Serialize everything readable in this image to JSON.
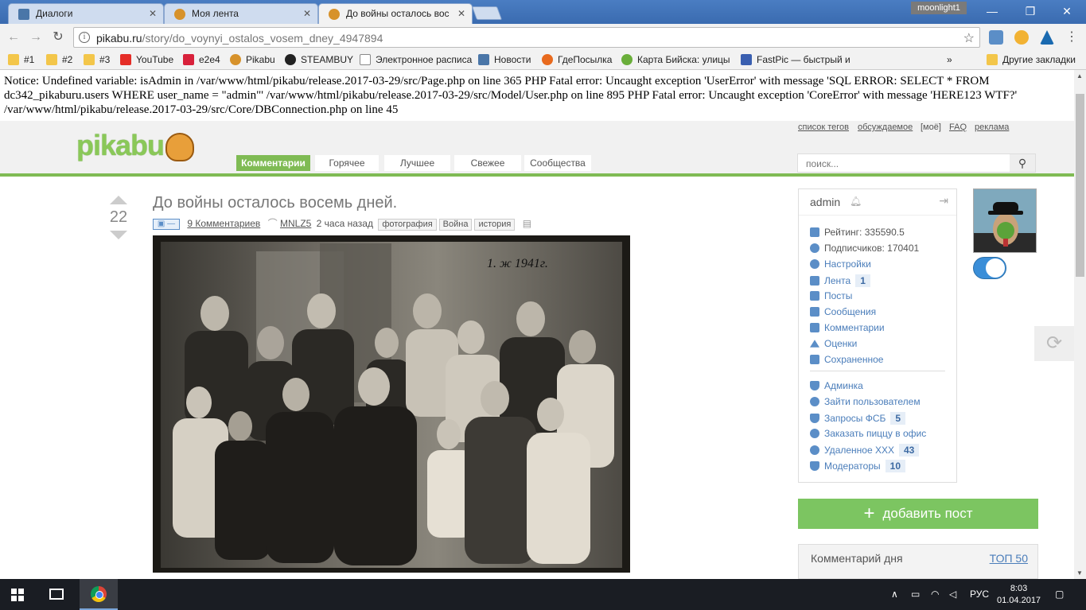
{
  "browser": {
    "tabs": [
      {
        "title": "Диалоги",
        "icon": "vk-icon",
        "color": "#4a76a8"
      },
      {
        "title": "Моя лента",
        "icon": "pikabu-icon",
        "color": "#d7922b"
      },
      {
        "title": "До войны осталось вос",
        "icon": "pikabu-icon",
        "color": "#d7922b"
      }
    ],
    "profile_name": "moonlight1",
    "url_domain": "pikabu.ru",
    "url_path": "/story/do_voynyi_ostalos_vosem_dney_4947894",
    "bookmarks": [
      {
        "label": "#1",
        "icon": "folder-icon"
      },
      {
        "label": "#2",
        "icon": "folder-icon"
      },
      {
        "label": "#3",
        "icon": "folder-icon"
      },
      {
        "label": "YouTube",
        "icon": "youtube-icon"
      },
      {
        "label": "e2e4",
        "icon": "e2e4-icon"
      },
      {
        "label": "Pikabu",
        "icon": "pikabu-icon"
      },
      {
        "label": "STEAMBUY",
        "icon": "steambuy-icon"
      },
      {
        "label": "Электронное расписа",
        "icon": "document-icon"
      },
      {
        "label": "Новости",
        "icon": "vk-icon"
      },
      {
        "label": "ГдеПосылка",
        "icon": "gdeposylka-icon"
      },
      {
        "label": "Карта Бийска: улицы",
        "icon": "map-icon"
      },
      {
        "label": "FastPic — быстрый и",
        "icon": "fastpic-icon"
      }
    ],
    "more_label": "»",
    "other_bookmarks": "Другие закладки"
  },
  "notice_text": "Notice: Undefined variable: isAdmin in /var/www/html/pikabu/release.2017-03-29/src/Page.php on line 365 PHP Fatal error: Uncaught exception 'UserError' with message 'SQL ERROR: SELECT * FROM dc342_pikaburu.users WHERE user_name = \"admin\"' /var/www/html/pikabu/release.2017-03-29/src/Model/User.php on line 895 PHP Fatal error: Uncaught exception 'CoreError' with message 'HERE123 WTF?' /var/www/html/pikabu/release.2017-03-29/src/Core/DBConnection.php on line 45",
  "site": {
    "logo": "pikabu",
    "top_links": [
      "список тегов",
      "обсуждаемое",
      "[моё]",
      "FAQ",
      "реклама"
    ],
    "nav_tabs": [
      "Комментарии",
      "Горячее",
      "Лучшее",
      "Свежее",
      "Сообщества"
    ],
    "search_placeholder": "поиск..."
  },
  "post": {
    "rating": "22",
    "title": "До войны осталось восемь дней.",
    "comments": "9 Комментариев",
    "author": "MNLZ5",
    "time": "2 часа назад",
    "tags": [
      "фотография",
      "Война",
      "история"
    ],
    "photo_inscription": "1. ж 1941г."
  },
  "user_panel": {
    "name": "admin",
    "rating": "Рейтинг: 335590.5",
    "subscribers": "Подписчиков: 170401",
    "links": [
      {
        "label": "Настройки",
        "icon": "gear-icon",
        "badge": ""
      },
      {
        "label": "Лента",
        "icon": "feed-icon",
        "badge": "1"
      },
      {
        "label": "Посты",
        "icon": "posts-icon",
        "badge": ""
      },
      {
        "label": "Сообщения",
        "icon": "mail-icon",
        "badge": ""
      },
      {
        "label": "Комментарии",
        "icon": "comment-icon",
        "badge": ""
      },
      {
        "label": "Оценки",
        "icon": "triangle-up-icon",
        "badge": ""
      },
      {
        "label": "Сохраненное",
        "icon": "save-icon",
        "badge": ""
      }
    ],
    "admin_links": [
      {
        "label": "Админка",
        "icon": "shield-icon",
        "badge": ""
      },
      {
        "label": "Зайти пользователем",
        "icon": "user-switch-icon",
        "badge": ""
      },
      {
        "label": "Запросы ФСБ",
        "icon": "question-shield-icon",
        "badge": "5"
      },
      {
        "label": "Заказать пиццу в офис",
        "icon": "pizza-icon",
        "badge": ""
      },
      {
        "label": "Удаленное XXX",
        "icon": "smile-icon",
        "badge": "43"
      },
      {
        "label": "Модераторы",
        "icon": "shield-icon",
        "badge": "10"
      }
    ]
  },
  "add_post": "добавить пост",
  "add_post_plus": "+",
  "comment_of_day": "Комментарий дня",
  "top50": "ТОП 50",
  "taskbar": {
    "lang": "РУС",
    "time": "8:03",
    "date": "01.04.2017"
  }
}
